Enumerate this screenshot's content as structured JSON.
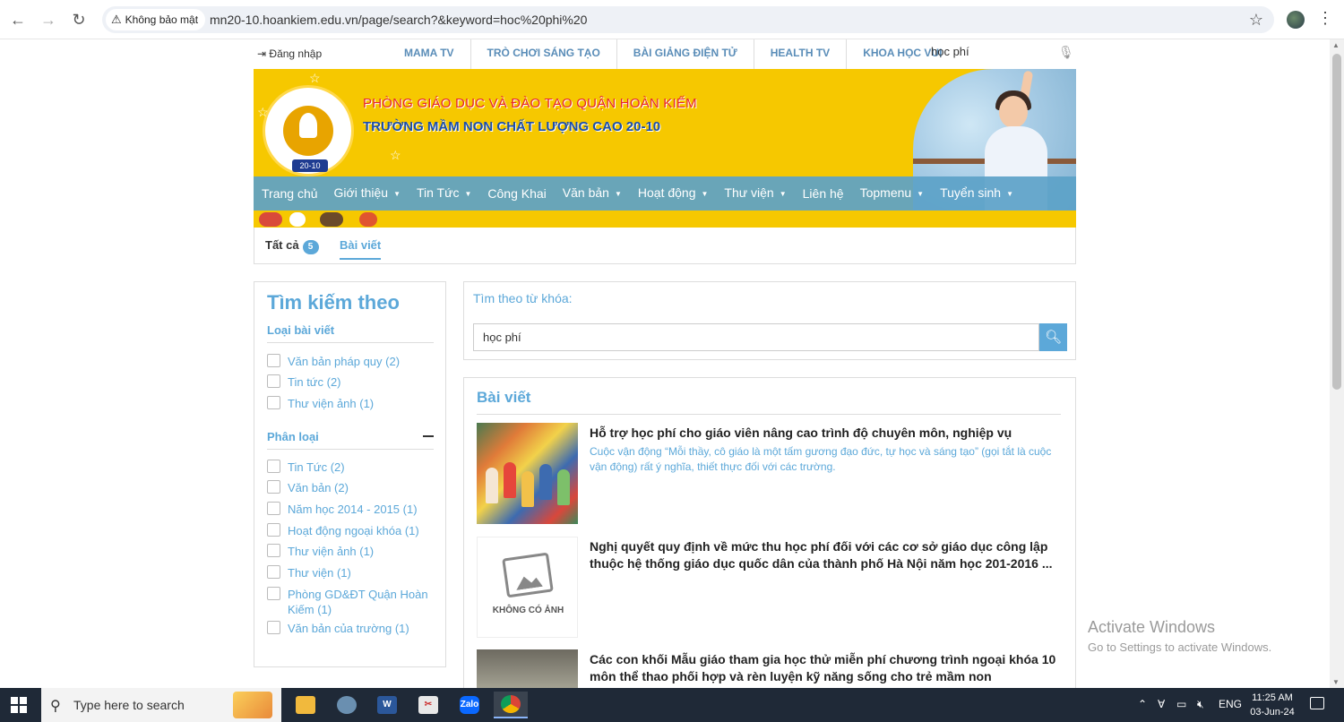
{
  "browser": {
    "security_label": "Không bảo mật",
    "url": "mn20-10.hoankiem.edu.vn/page/search?&keyword=hoc%20phi%20"
  },
  "topbar": {
    "login": "Đăng nhập",
    "links": [
      "MAMA TV",
      "TRÒ CHƠI SÁNG TẠO",
      "BÀI GIẢNG ĐIỆN TỬ",
      "HEALTH TV",
      "KHOA HỌC VUI"
    ],
    "search_value": "học phí"
  },
  "banner": {
    "line1": "PHÒNG GIÁO DỤC VÀ ĐÀO TẠO QUẬN HOÀN KIẾM",
    "line2": "TRƯỜNG MẦM NON CHẤT LƯỢNG CAO 20-10",
    "logo_badge": "20-10"
  },
  "menu": {
    "items": [
      {
        "label": "Trang chủ",
        "dropdown": false
      },
      {
        "label": "Giới thiệu",
        "dropdown": true
      },
      {
        "label": "Tin Tức",
        "dropdown": true
      },
      {
        "label": "Công Khai",
        "dropdown": false
      },
      {
        "label": "Văn bản",
        "dropdown": true
      },
      {
        "label": "Hoạt động",
        "dropdown": true
      },
      {
        "label": "Thư viện",
        "dropdown": true
      },
      {
        "label": "Liên hệ",
        "dropdown": false
      },
      {
        "label": "Topmenu",
        "dropdown": true
      },
      {
        "label": "Tuyển sinh",
        "dropdown": true
      }
    ]
  },
  "tabs": {
    "all_label": "Tất cả",
    "all_count": "5",
    "post_label": "Bài viết"
  },
  "sidebar": {
    "title": "Tìm kiếm theo",
    "section1": "Loại bài viết",
    "section1_items": [
      "Văn bản pháp quy (2)",
      "Tin tức (2)",
      "Thư viện ảnh (1)"
    ],
    "section2": "Phân loại",
    "section2_items": [
      "Tin Tức (2)",
      "Văn bản (2)",
      "Năm học 2014 - 2015 (1)",
      "Hoạt động ngoại khóa (1)",
      "Thư viện ảnh (1)",
      "Thư viện (1)",
      "Phòng GD&ĐT Quận Hoàn Kiếm (1)",
      "Văn bản của trường (1)"
    ]
  },
  "search": {
    "label": "Tìm theo từ khóa:",
    "value": "học phí"
  },
  "results": {
    "title": "Bài viết",
    "items": [
      {
        "title": "Hỗ trợ học phí cho giáo viên nâng cao trình độ chuyên môn, nghiệp vụ",
        "desc": "Cuộc vận động “Mỗi thầy, cô giáo là một tấm gương đạo đức, tự học và sáng tạo” (gọi tắt là cuộc vận động) rất ý nghĩa, thiết thực đối với các trường."
      },
      {
        "title": "Nghị quyết quy định về mức thu học phí đối với các cơ sở giáo dục công lập thuộc hệ thống giáo dục quốc dân của thành phố Hà Nội năm học 201-2016 ...",
        "desc": "",
        "no_image_label": "KHÔNG CÓ ẢNH"
      },
      {
        "title": "Các con khối Mẫu giáo tham gia học thử miễn phí chương trình ngoại khóa 10 môn thể thao phối hợp và rèn luyện kỹ năng sống cho trẻ mầm non",
        "desc": ""
      }
    ]
  },
  "activate": {
    "line1": "Activate Windows",
    "line2": "Go to Settings to activate Windows."
  },
  "taskbar": {
    "search_placeholder": "Type here to search",
    "lang": "ENG",
    "time": "11:25 AM",
    "date": "03-Jun-24"
  }
}
